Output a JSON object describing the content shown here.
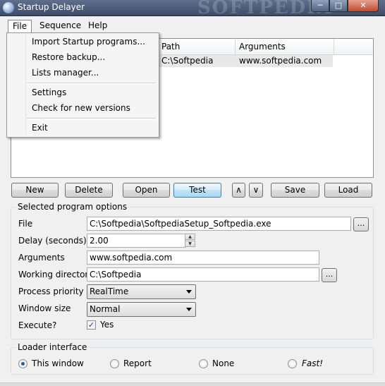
{
  "window": {
    "title": "Startup Delayer",
    "watermark": "SOFTPEDIA",
    "controls": {
      "minimize": "─",
      "maximize": "□",
      "close": "✕"
    }
  },
  "menubar": {
    "file": "File",
    "sequence": "Sequence",
    "help": "Help"
  },
  "file_menu": {
    "items": [
      "Import Startup programs...",
      "Restore backup...",
      "Lists manager...",
      "Settings",
      "Check for new versions",
      "Exit"
    ]
  },
  "list": {
    "columns": [
      "Path",
      "Arguments"
    ],
    "rows": [
      {
        "path": "C:\\Softpedia",
        "arguments": "www.softpedia.com"
      }
    ]
  },
  "toolbar": {
    "new": "New",
    "delete": "Delete",
    "open": "Open",
    "test": "Test",
    "up": "∧",
    "down": "∨",
    "save": "Save",
    "load": "Load"
  },
  "options": {
    "title": "Selected program options",
    "file_label": "File",
    "file_value": "C:\\Softpedia\\SoftpediaSetup_Softpedia.exe",
    "delay_label": "Delay (seconds)",
    "delay_value": "2.00",
    "arguments_label": "Arguments",
    "arguments_value": "www.softpedia.com",
    "workdir_label": "Working directory",
    "workdir_value": "C:\\Softpedia",
    "priority_label": "Process priority",
    "priority_value": "RealTime",
    "winsize_label": "Window size",
    "winsize_value": "Normal",
    "execute_label": "Execute?",
    "execute_value": "Yes",
    "execute_checked": true,
    "browse": "..."
  },
  "loader": {
    "title": "Loader interface",
    "options": [
      "This window",
      "Report",
      "None",
      "Fast!"
    ],
    "selected": "This window"
  },
  "colors": {
    "accent": "#3c7fb1",
    "titlebar": "#4a5a78"
  }
}
